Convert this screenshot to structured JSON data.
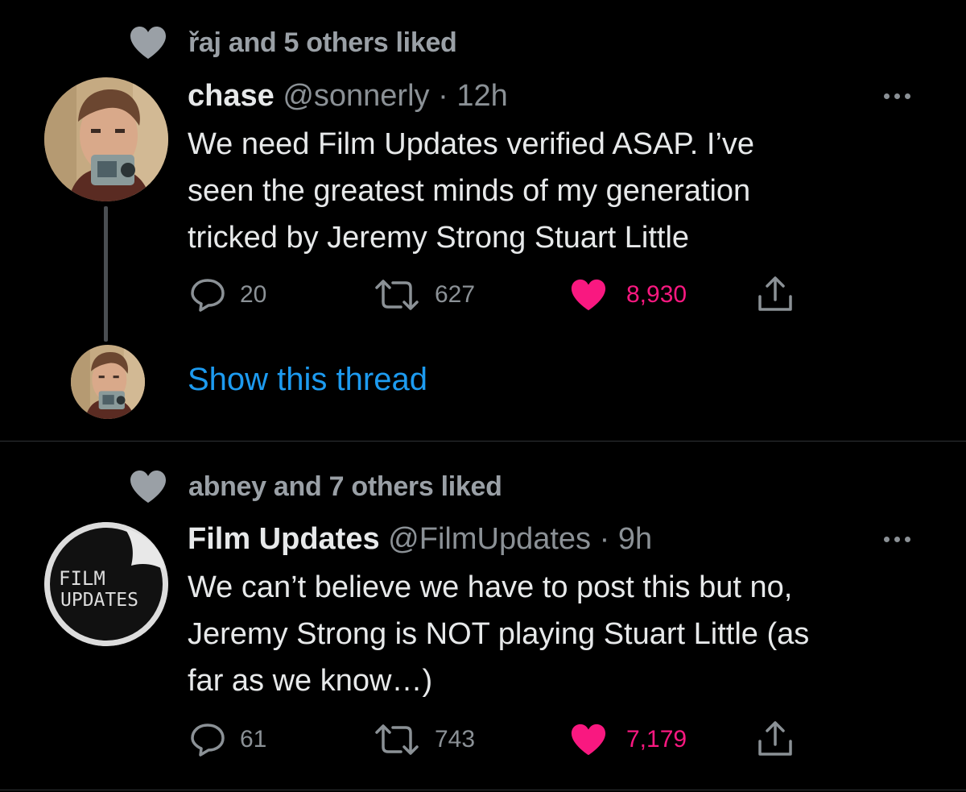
{
  "tweets": [
    {
      "social_context": "řaj and 5 others liked",
      "author_name": "chase",
      "handle": "@sonnerly",
      "separator": "·",
      "time": "12h",
      "text_lines": [
        "We need Film Updates verified ASAP. I’ve",
        "seen the greatest minds of my generation",
        "tricked by Jeremy Strong Stuart Little"
      ],
      "replies": "20",
      "retweets": "627",
      "likes": "8,930",
      "liked": true,
      "show_thread_label": "Show this thread"
    },
    {
      "social_context": "abney and 7 others liked",
      "author_name": "Film Updates",
      "handle": "@FilmUpdates",
      "separator": "·",
      "time": "9h",
      "avatar_text": [
        "FILM",
        "UPDATES"
      ],
      "text_lines": [
        "We can’t believe we have to post this but no,",
        "Jeremy Strong is NOT playing Stuart Little (as",
        "far as we know…)"
      ],
      "replies": "61",
      "retweets": "743",
      "likes": "7,179",
      "liked": true
    }
  ],
  "icons": {
    "social": "heart-icon",
    "reply": "reply-icon",
    "retweet": "retweet-icon",
    "like": "heart-filled-icon",
    "share": "share-icon",
    "more": "more-dots-icon"
  },
  "colors": {
    "background": "#000000",
    "text": "#e7e9ea",
    "secondary": "#8b9196",
    "like": "#f91880",
    "link": "#1d9bf0"
  }
}
